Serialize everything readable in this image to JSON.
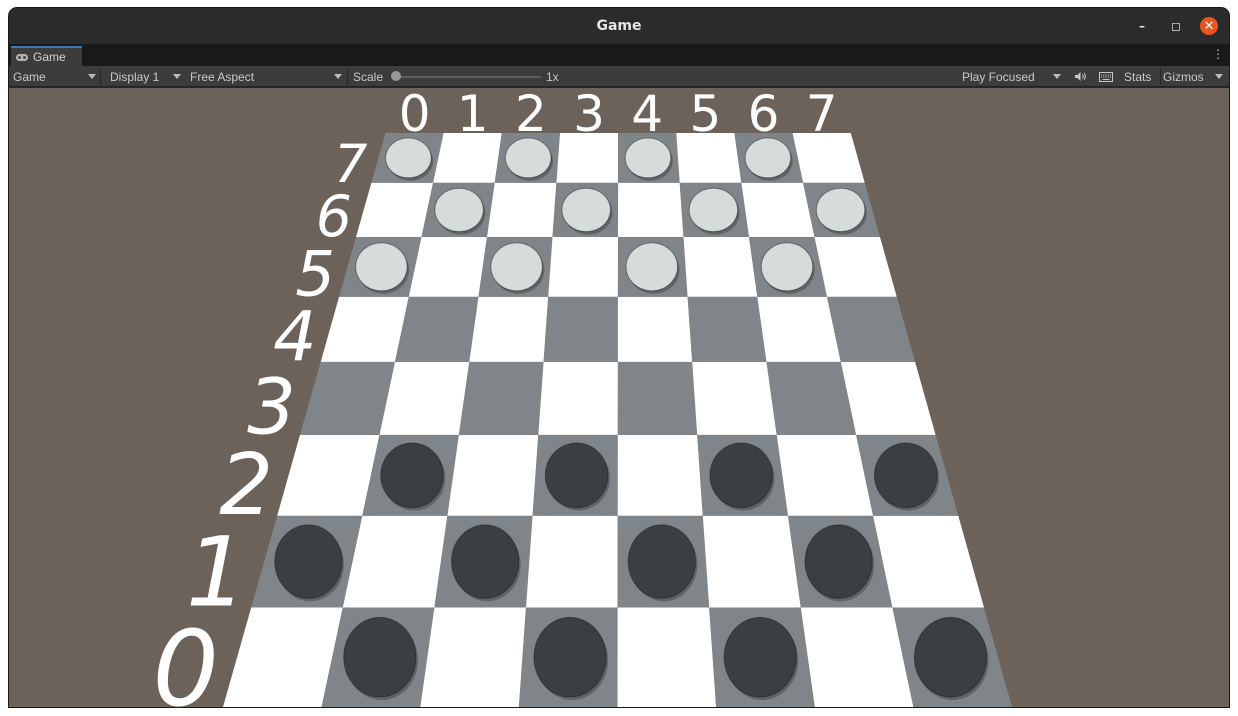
{
  "window": {
    "title": "Game"
  },
  "tab": {
    "label": "Game"
  },
  "toolbar": {
    "view_select": "Game",
    "display_select": "Display 1",
    "aspect_select": "Free Aspect",
    "scale_label": "Scale",
    "scale_value": "1x",
    "play_mode_select": "Play Focused",
    "stats_label": "Stats",
    "gizmos_label": "Gizmos"
  },
  "icons": [
    "gamepad-icon",
    "audio-icon",
    "keyboard-icon",
    "kebab-menu-icon",
    "minimize-icon",
    "maximize-icon",
    "close-icon"
  ],
  "board": {
    "column_labels": [
      "0",
      "1",
      "2",
      "3",
      "4",
      "5",
      "6",
      "7"
    ],
    "row_labels": [
      "7",
      "6",
      "5",
      "4",
      "3",
      "2",
      "1",
      "0"
    ],
    "light_square_color": "#ffffff",
    "dark_square_color": "#7f8589",
    "white_piece_color": "#d5dcda",
    "black_piece_color": "#3c3f42",
    "white_pieces": [
      [
        7,
        0
      ],
      [
        7,
        2
      ],
      [
        7,
        4
      ],
      [
        7,
        6
      ],
      [
        6,
        1
      ],
      [
        6,
        3
      ],
      [
        6,
        5
      ],
      [
        6,
        7
      ],
      [
        5,
        0
      ],
      [
        5,
        2
      ],
      [
        5,
        4
      ],
      [
        5,
        6
      ]
    ],
    "black_pieces": [
      [
        2,
        1
      ],
      [
        2,
        3
      ],
      [
        2,
        5
      ],
      [
        2,
        7
      ],
      [
        1,
        0
      ],
      [
        1,
        2
      ],
      [
        1,
        4
      ],
      [
        1,
        6
      ],
      [
        0,
        1
      ],
      [
        0,
        3
      ],
      [
        0,
        5
      ],
      [
        0,
        7
      ]
    ]
  }
}
